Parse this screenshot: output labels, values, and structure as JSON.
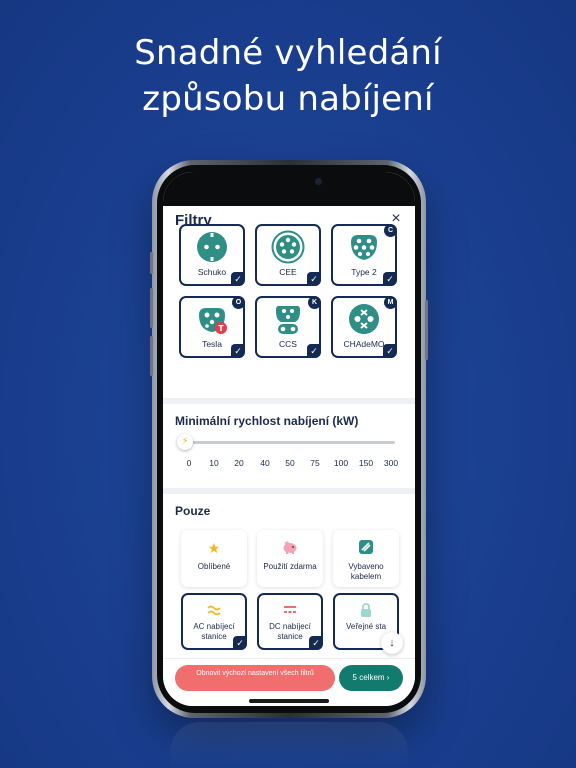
{
  "headline": {
    "line1": "Snadné vyhledání",
    "line2": "způsobu nabíjení"
  },
  "sheet": {
    "title": "Filtry",
    "close_icon": "×"
  },
  "plugs": [
    {
      "label": "Schuko",
      "selected": true,
      "badge": ""
    },
    {
      "label": "CEE",
      "selected": true,
      "badge": ""
    },
    {
      "label": "Type 2",
      "selected": true,
      "badge": "C"
    },
    {
      "label": "Tesla",
      "selected": true,
      "badge": "O"
    },
    {
      "label": "CCS",
      "selected": true,
      "badge": "K"
    },
    {
      "label": "CHAdeMO",
      "selected": true,
      "badge": "M"
    }
  ],
  "speed": {
    "title": "Minimální rychlost nabíjení (kW)",
    "ticks": [
      "0",
      "10",
      "20",
      "40",
      "50",
      "75",
      "100",
      "150",
      "300"
    ],
    "value": 0
  },
  "only": {
    "title": "Pouze",
    "options": [
      {
        "label": "Oblíbené",
        "icon": "star-icon",
        "selected": false
      },
      {
        "label": "Použití zdarma",
        "icon": "piggy-bank-icon",
        "selected": false
      },
      {
        "label": "Vybaveno kabelem",
        "icon": "cable-icon",
        "selected": false
      },
      {
        "label": "AC nabíjecí stanice",
        "icon": "ac-current-icon",
        "selected": true
      },
      {
        "label": "DC nabíjecí stanice",
        "icon": "dc-current-icon",
        "selected": true
      },
      {
        "label": "Veřejné sta",
        "icon": "lock-icon",
        "selected": true
      }
    ]
  },
  "footer": {
    "reset_label": "Obnovit výchozí nastavení všech filtrů",
    "apply_label": "5 celkem ›"
  },
  "colors": {
    "background": "#1a3f8f",
    "navy": "#152a52",
    "reset": "#f06e6e",
    "apply": "#127a6e",
    "teal": "#2f8e86"
  }
}
